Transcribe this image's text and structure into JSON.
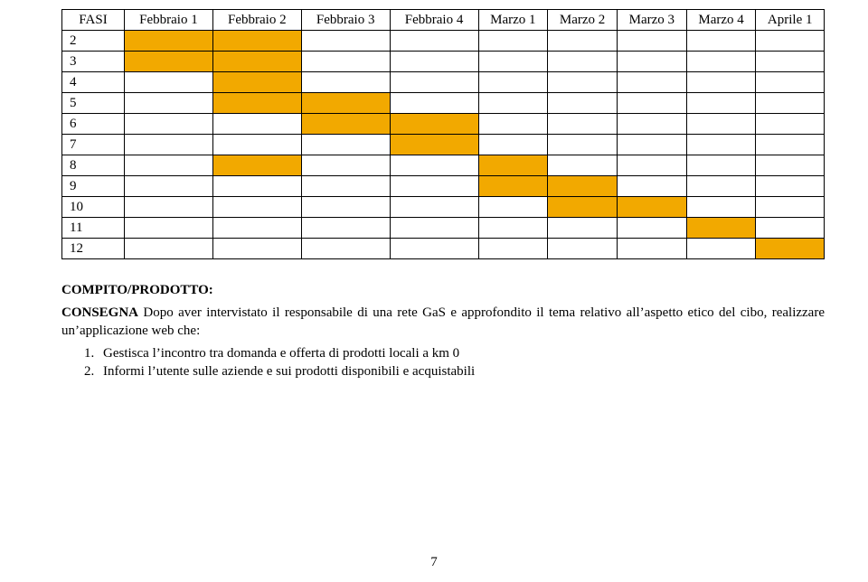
{
  "gantt": {
    "header": [
      "FASI",
      "Febbraio 1",
      "Febbraio 2",
      "Febbraio 3",
      "Febbraio 4",
      "Marzo 1",
      "Marzo 2",
      "Marzo 3",
      "Marzo 4",
      "Aprile 1"
    ],
    "rows": [
      {
        "label": "2",
        "cells": [
          true,
          true,
          false,
          false,
          false,
          false,
          false,
          false,
          false
        ]
      },
      {
        "label": "3",
        "cells": [
          true,
          true,
          false,
          false,
          false,
          false,
          false,
          false,
          false
        ]
      },
      {
        "label": "4",
        "cells": [
          false,
          true,
          false,
          false,
          false,
          false,
          false,
          false,
          false
        ]
      },
      {
        "label": "5",
        "cells": [
          false,
          true,
          true,
          false,
          false,
          false,
          false,
          false,
          false
        ]
      },
      {
        "label": "6",
        "cells": [
          false,
          false,
          true,
          true,
          false,
          false,
          false,
          false,
          false
        ]
      },
      {
        "label": "7",
        "cells": [
          false,
          false,
          false,
          true,
          false,
          false,
          false,
          false,
          false
        ]
      },
      {
        "label": "8",
        "cells": [
          false,
          true,
          false,
          false,
          true,
          false,
          false,
          false,
          false
        ]
      },
      {
        "label": "9",
        "cells": [
          false,
          false,
          false,
          false,
          true,
          true,
          false,
          false,
          false
        ]
      },
      {
        "label": "10",
        "cells": [
          false,
          false,
          false,
          false,
          false,
          true,
          true,
          false,
          false
        ]
      },
      {
        "label": "11",
        "cells": [
          false,
          false,
          false,
          false,
          false,
          false,
          false,
          true,
          false
        ]
      },
      {
        "label": "12",
        "cells": [
          false,
          false,
          false,
          false,
          false,
          false,
          false,
          false,
          true
        ]
      }
    ]
  },
  "section": {
    "title": "COMPITO/PRODOTTO:",
    "lead_strong": "CONSEGNA",
    "lead_rest": " Dopo aver intervistato il responsabile di una rete GaS e approfondito il tema relativo all’aspetto etico del cibo, realizzare un’applicazione web che:",
    "steps": [
      "Gestisca l’incontro tra domanda e offerta di prodotti locali a km 0",
      "Informi l’utente sulle aziende e sui prodotti disponibili e acquistabili"
    ]
  },
  "pagenum": "7"
}
